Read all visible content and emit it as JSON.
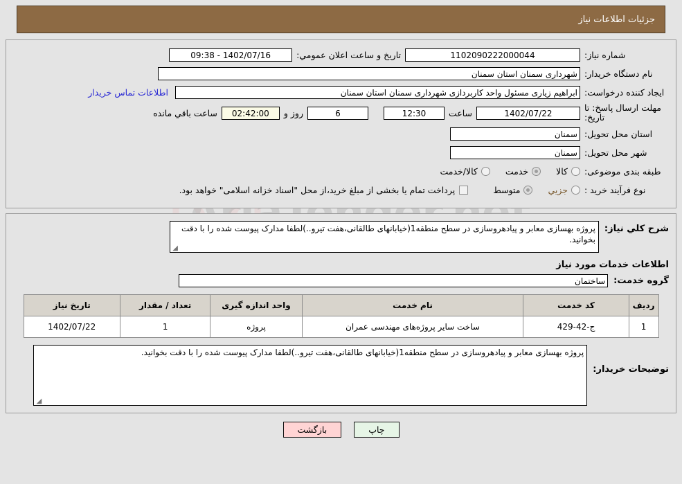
{
  "header": {
    "title": "جزئیات اطلاعات نیاز"
  },
  "form": {
    "need_number_label": "شماره نیاز:",
    "need_number_value": "1102090222000044",
    "announce_label": "تاریخ و ساعت اعلان عمومي:",
    "announce_value": "1402/07/16 - 09:38",
    "buyer_org_label": "نام دستگاه خریدار:",
    "buyer_org_value": "شهرداری سمنان استان سمنان",
    "creator_label": "ایجاد کننده درخواست:",
    "creator_value": "ابراهیم زیاری مسئول واحد کاربردازی شهرداری سمنان استان سمنان",
    "contact_link": "اطلاعات تماس خریدار",
    "deadline_label": "مهلت ارسال پاسخ: تا تاریخ:",
    "deadline_date": "1402/07/22",
    "hour_label": "ساعت",
    "deadline_time": "12:30",
    "days_value": "6",
    "days_label": "روز و",
    "countdown_value": "02:42:00",
    "countdown_label": "ساعت باقي مانده",
    "province_label": "استان محل تحویل:",
    "province_value": "سمنان",
    "city_label": "شهر محل تحویل:",
    "city_value": "سمنان",
    "category_label": "طبقه بندی موضوعی:",
    "category_options": [
      {
        "label": "کالا",
        "checked": false
      },
      {
        "label": "خدمت",
        "checked": true
      },
      {
        "label": "کالا/خدمت",
        "checked": false
      }
    ],
    "process_label": "نوع فرآیند خرید :",
    "process_options": [
      {
        "label": "جزیي",
        "checked": false
      },
      {
        "label": "متوسط",
        "checked": true
      }
    ],
    "treasury_checkbox_label": "پرداخت تمام یا بخشی از مبلغ خرید،از محل \"اسناد خزانه اسلامی\" خواهد بود.",
    "treasury_checked": false
  },
  "detail": {
    "general_desc_label": "شرح كلي نياز:",
    "general_desc_value": "پروژه بهسازی معابر و پیادهروسازی در سطح منطقه1(خیابانهای طالقانی،هفت تیرو..)لطفا مدارک پیوست شده را با دقت بخوانید.",
    "services_section_title": "اطلاعات خدمات مورد نیاز",
    "service_group_label": "گروه خدمت:",
    "service_group_value": "ساختمان",
    "buyer_notes_label": "توضیحات خریدار:",
    "buyer_notes_value": "پروژه بهسازی معابر و پیادهروسازی در سطح منطقه1(خیابانهای طالقانی،هفت تیرو..)لطفا مدارک پیوست شده را با دقت بخوانید."
  },
  "table": {
    "headers": [
      "ردیف",
      "کد خدمت",
      "نام خدمت",
      "واحد اندازه گیری",
      "تعداد / مقدار",
      "تاریخ نیاز"
    ],
    "rows": [
      {
        "radif": "1",
        "code": "ج-42-429",
        "name": "ساخت سایر پروژه‌های مهندسی عمران",
        "unit": "پروژه",
        "qty": "1",
        "date": "1402/07/22"
      }
    ]
  },
  "buttons": {
    "print": "چاپ",
    "back": "بازگشت"
  },
  "watermark": {
    "text": "AriaTender.net"
  },
  "colors": {
    "header_bg": "#8d6a44",
    "page_bg": "#e4e4e4",
    "link": "#2a2ad4",
    "table_head_bg": "#d8d4cc",
    "print_btn_bg": "#e6f5e6",
    "back_btn_bg": "#ffd4d4",
    "countdown_bg": "#fbfbe6"
  }
}
